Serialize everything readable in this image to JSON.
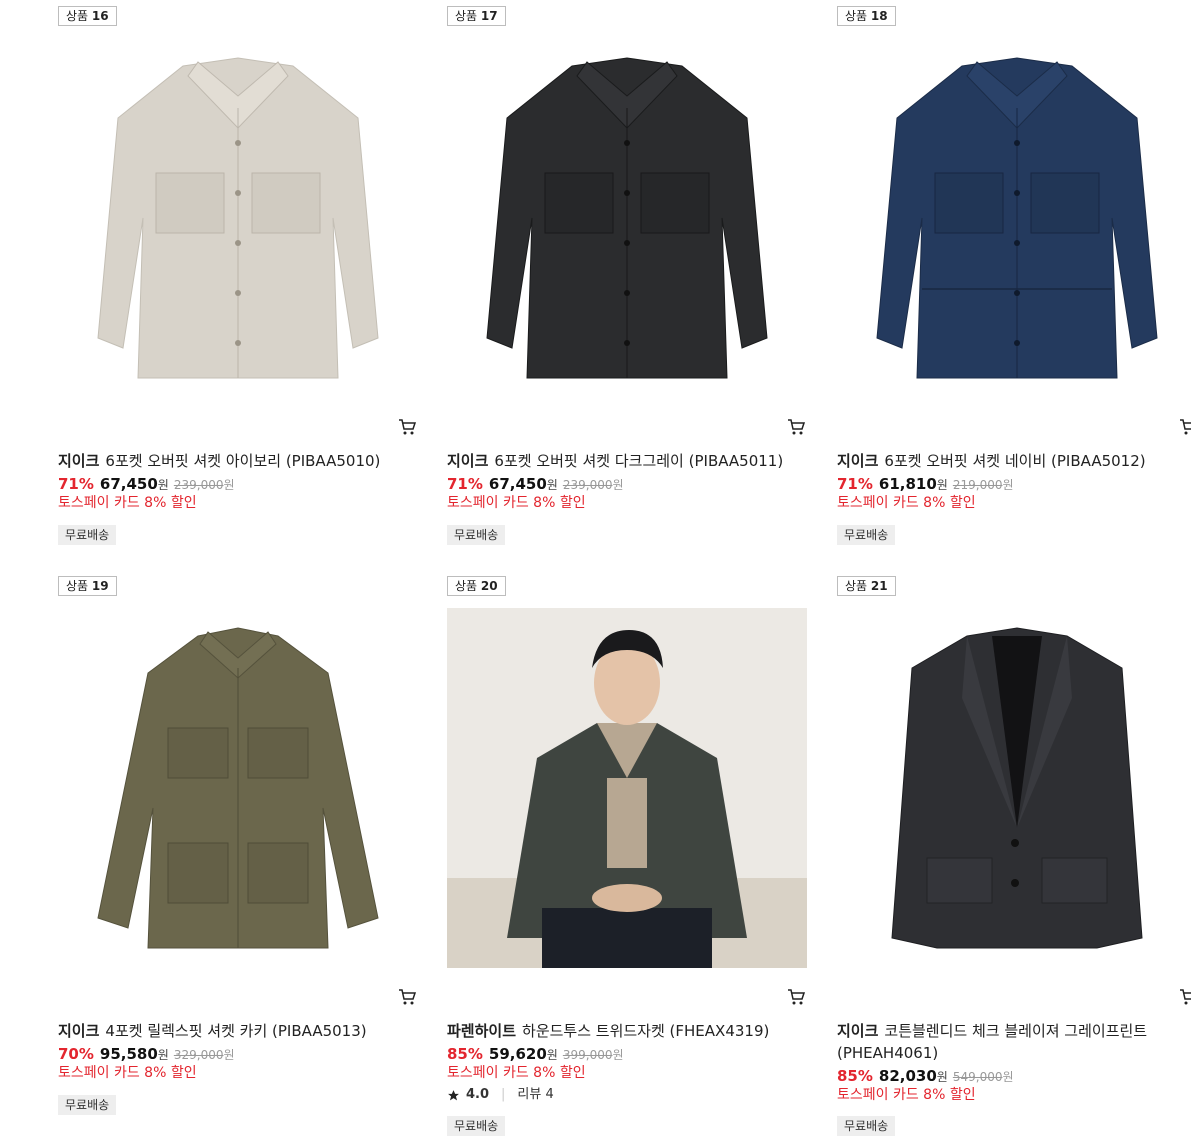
{
  "products": [
    {
      "badge_label": "상품",
      "badge_num": "16",
      "brand": "지이크",
      "name": "6포켓 오버핏 셔켓 아이보리 (PIBAA5010)",
      "discount": "71%",
      "price": "67,450",
      "won": "원",
      "original_price": "239,000",
      "original_won": "원",
      "promo": "토스페이 카드 8% 할인",
      "shipping": "무료배송",
      "image": "shirt-jacket-ivory",
      "color": "#d8d3ca"
    },
    {
      "badge_label": "상품",
      "badge_num": "17",
      "brand": "지이크",
      "name": "6포켓 오버핏 셔켓 다크그레이 (PIBAA5011)",
      "discount": "71%",
      "price": "67,450",
      "won": "원",
      "original_price": "239,000",
      "original_won": "원",
      "promo": "토스페이 카드 8% 할인",
      "shipping": "무료배송",
      "image": "shirt-jacket-darkgray",
      "color": "#2b2c2e"
    },
    {
      "badge_label": "상품",
      "badge_num": "18",
      "brand": "지이크",
      "name": "6포켓 오버핏 셔켓 네이비 (PIBAA5012)",
      "discount": "71%",
      "price": "61,810",
      "won": "원",
      "original_price": "219,000",
      "original_won": "원",
      "promo": "토스페이 카드 8% 할인",
      "shipping": "무료배송",
      "image": "shirt-jacket-denim-navy",
      "color": "#243a5e"
    },
    {
      "badge_label": "상품",
      "badge_num": "19",
      "brand": "지이크",
      "name": "4포켓 릴렉스핏 셔켓 카키 (PIBAA5013)",
      "discount": "70%",
      "price": "95,580",
      "won": "원",
      "original_price": "329,000",
      "original_won": "원",
      "promo": "토스페이 카드 8% 할인",
      "shipping": "무료배송",
      "image": "field-jacket-khaki",
      "color": "#6b674c"
    },
    {
      "badge_label": "상품",
      "badge_num": "20",
      "brand": "파렌하이트",
      "name": "하운드투스 트위드자켓 (FHEAX4319)",
      "discount": "85%",
      "price": "59,620",
      "won": "원",
      "original_price": "399,000",
      "original_won": "원",
      "promo": "토스페이 카드 8% 할인",
      "shipping": "무료배송",
      "rating": "4.0",
      "review_label": "리뷰 4",
      "image": "model-houndstooth-tweed-jacket",
      "color": "#3f4540"
    },
    {
      "badge_label": "상품",
      "badge_num": "21",
      "brand": "지이크",
      "name": "코튼블렌디드 체크 블레이져 그레이프린트 (PHEAH4061)",
      "discount": "85%",
      "price": "82,030",
      "won": "원",
      "original_price": "549,000",
      "original_won": "원",
      "promo": "토스페이 카드 8% 할인",
      "shipping": "무료배송",
      "image": "check-blazer-gray",
      "color": "#2e2f33"
    }
  ],
  "icons": {
    "cart": "cart-icon",
    "star": "star-icon"
  },
  "accent_color": "#e3262f"
}
